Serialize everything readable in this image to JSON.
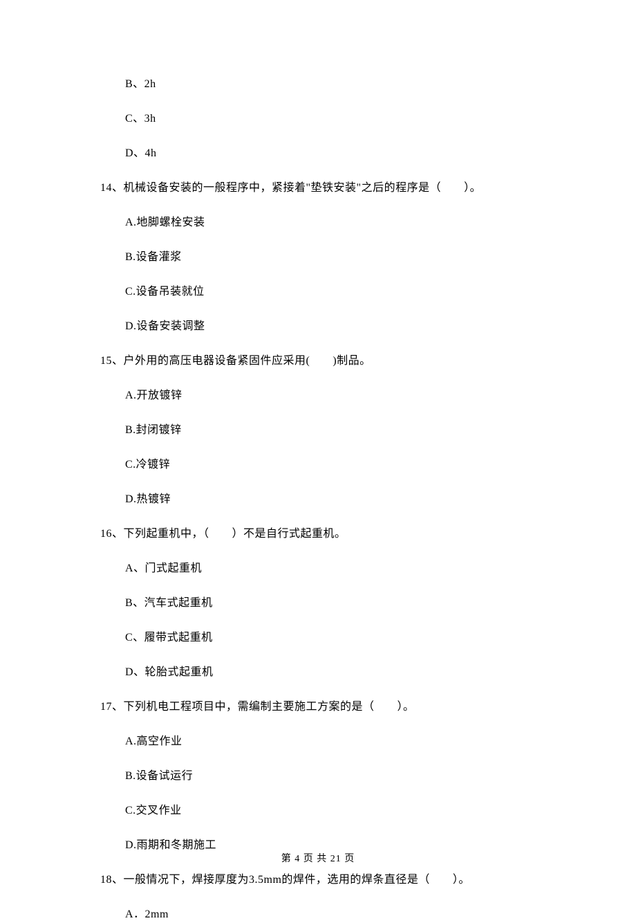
{
  "opts_top": [
    "B、2h",
    "C、3h",
    "D、4h"
  ],
  "q14": {
    "stem": "14、机械设备安装的一般程序中，紧接着\"垫铁安装\"之后的程序是（　　）。",
    "opts": [
      "A.地脚螺栓安装",
      "B.设备灌浆",
      "C.设备吊装就位",
      "D.设备安装调整"
    ]
  },
  "q15": {
    "stem": "15、户外用的高压电器设备紧固件应采用(　　)制品。",
    "opts": [
      "A.开放镀锌",
      "B.封闭镀锌",
      "C.冷镀锌",
      "D.热镀锌"
    ]
  },
  "q16": {
    "stem": "16、下列起重机中，（　　）不是自行式起重机。",
    "opts": [
      "A、门式起重机",
      "B、汽车式起重机",
      "C、履带式起重机",
      "D、轮胎式起重机"
    ]
  },
  "q17": {
    "stem": "17、下列机电工程项目中，需编制主要施工方案的是（　　）。",
    "opts": [
      "A.高空作业",
      "B.设备试运行",
      "C.交叉作业",
      "D.雨期和冬期施工"
    ]
  },
  "q18": {
    "stem": "18、一般情况下，焊接厚度为3.5mm的焊件，选用的焊条直径是（　　）。",
    "opts": [
      "A．2mm"
    ]
  },
  "footer": "第 4 页 共 21 页"
}
